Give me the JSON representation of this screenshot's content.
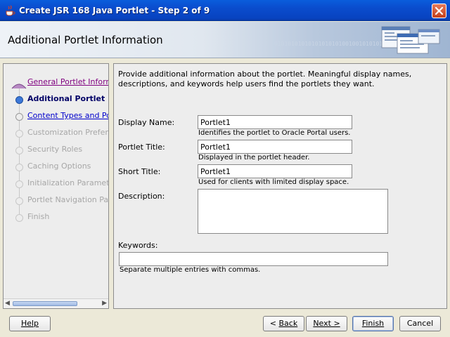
{
  "window": {
    "title": "Create JSR 168 Java Portlet - Step 2 of 9"
  },
  "header": {
    "title": "Additional Portlet Information",
    "binary_text": "01010101010101010101001001010101"
  },
  "nav": {
    "items": [
      {
        "label": "General Portlet Information",
        "state": "visited"
      },
      {
        "label": "Additional Portlet Information",
        "state": "current"
      },
      {
        "label": "Content Types and Portlet Modes",
        "state": "link"
      },
      {
        "label": "Customization Preferences",
        "state": "disabled"
      },
      {
        "label": "Security Roles",
        "state": "disabled"
      },
      {
        "label": "Caching Options",
        "state": "disabled"
      },
      {
        "label": "Initialization Parameters",
        "state": "disabled"
      },
      {
        "label": "Portlet Navigation Parameters",
        "state": "disabled"
      },
      {
        "label": "Finish",
        "state": "disabled"
      }
    ]
  },
  "main": {
    "intro": "Provide additional information about the portlet. Meaningful display names, descriptions, and keywords help users find the portlets they want.",
    "display_name": {
      "label": "Display Name:",
      "value": "Portlet1",
      "hint": "Identifies the portlet to Oracle Portal users."
    },
    "portlet_title": {
      "label": "Portlet Title:",
      "value": "Portlet1",
      "hint": "Displayed in the portlet header."
    },
    "short_title": {
      "label": "Short Title:",
      "value": "Portlet1",
      "hint": "Used for clients with limited display space."
    },
    "description": {
      "label": "Description:",
      "value": ""
    },
    "keywords": {
      "label": "Keywords:",
      "value": "",
      "hint": "Separate multiple entries with commas."
    }
  },
  "buttons": {
    "help": "Help",
    "back_prefix": "< ",
    "back": "Back",
    "next": "Next >",
    "finish": "Finish",
    "cancel": "Cancel"
  }
}
